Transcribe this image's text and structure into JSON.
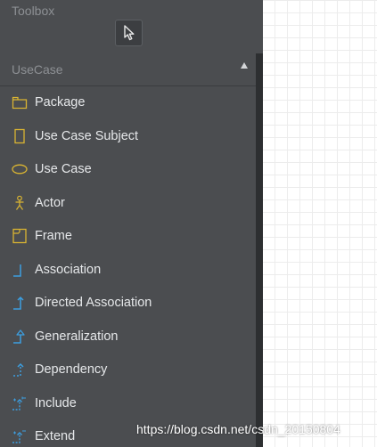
{
  "toolbox": {
    "title": "Toolbox",
    "section": {
      "title": "UseCase"
    },
    "items": [
      {
        "label": "Package",
        "icon": "package-icon"
      },
      {
        "label": "Use Case Subject",
        "icon": "use-case-subject-icon"
      },
      {
        "label": "Use Case",
        "icon": "use-case-icon"
      },
      {
        "label": "Actor",
        "icon": "actor-icon"
      },
      {
        "label": "Frame",
        "icon": "frame-icon"
      },
      {
        "label": "Association",
        "icon": "association-icon"
      },
      {
        "label": "Directed Association",
        "icon": "directed-association-icon"
      },
      {
        "label": "Generalization",
        "icon": "generalization-icon"
      },
      {
        "label": "Dependency",
        "icon": "dependency-icon"
      },
      {
        "label": "Include",
        "icon": "include-icon"
      },
      {
        "label": "Extend",
        "icon": "extend-icon"
      }
    ]
  },
  "watermark": "https://blog.csdn.net/csdn_20150804",
  "colors": {
    "panel": "#4b4d50",
    "node_icon": "#d9b432",
    "relation_icon": "#3c9ee0",
    "label_text": "#e6e8ea",
    "header_text": "#8d9094"
  }
}
